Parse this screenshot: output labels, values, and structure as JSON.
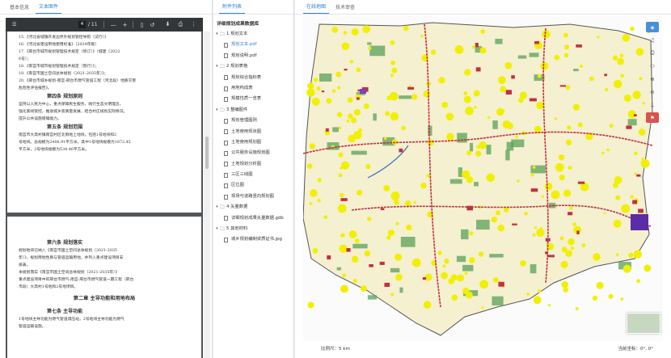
{
  "left_panel": {
    "tabs": [
      "基本信息",
      "文本图件"
    ],
    "active_tab_index": 1,
    "pdf_toolbar": {
      "current_page": "4",
      "total_pages": "/ 11"
    },
    "page1": {
      "lines": [
        "15.《河北省城镇开发边界外规划管控导则（试行）》",
        "16.《河北省建设用地使用标准》（2024年版）",
        "17.《邢台市城市规划管理技术规定（修订）》（城建〔2022",
        "6号）；",
        "18.《南宫市城市规划管理技术规定（暂行）》；",
        "19.《南宫市国土空间总体规划（2021-2035年）》；",
        "20.《邢台市城乡规划-南宫-邢台市燃气管道工程（河北段）地质灾害",
        "危险性评估报告》。"
      ],
      "section4_title": "第四条 规划原则",
      "section4_lines": [
        "坚持以人民为中心，重点保障民生服务，践行生态文明理念，",
        "强化底线管控，推进城乡高质量发展，结合村庄规划实际情况，",
        "提升公共设施保障能力。"
      ],
      "section5_title": "第五条 规划范围",
      "section5_lines": [
        "南宫市大高村镇南宫村区北侧地上地块，包括1号地块和2",
        "号地块。总规模为2406.91平方米，其中1号地块规模为1872.45",
        "平方米，2号地块规模为534.46平方米。"
      ]
    },
    "page2": {
      "section6_title": "第六条 规划落实",
      "section6_lines": [
        "规划地块已纳入《南宫市国土空间总体规划（2021-2035",
        "年）》，规划用地性质与管道运输用地，并列入重点建设项目安",
        "排表。",
        "本规划落实《南宫市国土空间总体规划（2021-2035年）》",
        "重点建设项目中的邢台市燃气-南宫-邢台市燃气管道一期工程（邢台",
        "市段）大高村1号地和2号地项目。"
      ],
      "chapter_title": "第二章 主导功能和用地布局",
      "section7_title": "第七条 主导功能",
      "section7_lines": [
        "1号地块主导功能为燃气管道调压站，2号地块主导功能为燃气",
        "管道运输设施。"
      ]
    }
  },
  "middle_panel": {
    "tabs": [
      "附件列表"
    ],
    "tree_title": "详细规划成果数据库",
    "tree": [
      {
        "type": "folder",
        "label": "1 规划文本"
      },
      {
        "type": "file",
        "label": "规划文本.pdf",
        "selected": true
      },
      {
        "type": "file",
        "label": "规划说明.pdf"
      },
      {
        "type": "folder",
        "label": "2 规划表格"
      },
      {
        "type": "file",
        "label": "规划综合指标表"
      },
      {
        "type": "file",
        "label": "用地构成表"
      },
      {
        "type": "file",
        "label": "规模性质一览表"
      },
      {
        "type": "folder",
        "label": "3 整编图件"
      },
      {
        "type": "file",
        "label": "规划管理图则"
      },
      {
        "type": "file",
        "label": "土地使用现状图"
      },
      {
        "type": "file",
        "label": "土地使用规划图"
      },
      {
        "type": "file",
        "label": "公共服务设施规划图"
      },
      {
        "type": "file",
        "label": "土地规划分析图"
      },
      {
        "type": "file",
        "label": "三区三线图"
      },
      {
        "type": "file",
        "label": "区位图"
      },
      {
        "type": "file",
        "label": "现场与道路竖向规划图"
      },
      {
        "type": "folder",
        "label": "4 矢量数据"
      },
      {
        "type": "file",
        "label": "详细规划成果矢量数据.gdb"
      },
      {
        "type": "folder",
        "label": "5 其他材料"
      },
      {
        "type": "file",
        "label": "城乡规划编制资质证书.jpg"
      }
    ]
  },
  "right_panel": {
    "tabs": [
      "在线地图",
      "技术审查"
    ],
    "active_tab_index": 0,
    "map_tools": [
      "layers-icon",
      "bell-icon",
      "print-icon",
      "person-icon",
      "zoom-in-icon",
      "zoom-out-icon",
      "measure-icon",
      "marker-icon"
    ],
    "scale_label": "比例尺：",
    "scale_value": "5 km",
    "coords_label": "当前坐标：",
    "coords_value": "0°, 0°",
    "colors": {
      "settlement": "#f0f000",
      "farmland": "#f5f0cf",
      "green": "#5aa05a",
      "roads": "#c23040",
      "water": "#3a6fbf",
      "boundary": "#555555"
    }
  }
}
